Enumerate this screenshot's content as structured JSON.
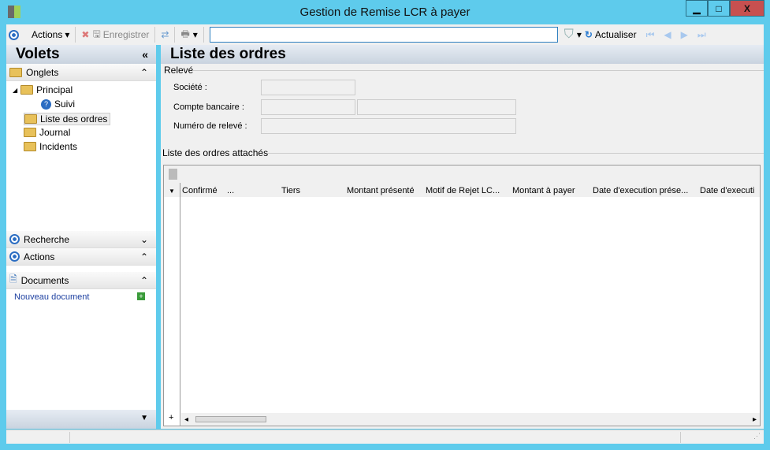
{
  "window": {
    "title": "Gestion de Remise LCR à payer",
    "minimize": "▁",
    "maximize": "□",
    "close": "X"
  },
  "toolbar": {
    "actions": "Actions",
    "save": "Enregistrer",
    "search_value": "",
    "refresh": "Actualiser"
  },
  "left": {
    "title": "Volets",
    "collapse": "«",
    "onglets": "Onglets",
    "tree": [
      "Principal",
      "Suivi",
      "Liste des ordres",
      "Journal",
      "Incidents"
    ],
    "recherche": "Recherche",
    "actions": "Actions",
    "documents": "Documents",
    "new_doc": "Nouveau document"
  },
  "main": {
    "title": "Liste des ordres",
    "releve": "Relevé",
    "societe": "Société :",
    "compte": "Compte bancaire :",
    "numero": "Numéro de relevé :",
    "list_title": "Liste des ordres attachés",
    "columns": [
      "Confirmé",
      "...",
      "Tiers",
      "Montant présenté",
      "Motif de Rejet LC...",
      "Montant à payer",
      "Date d'execution prése...",
      "Date d'executi"
    ]
  }
}
